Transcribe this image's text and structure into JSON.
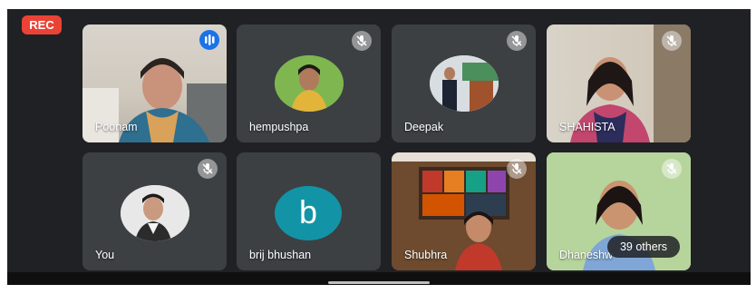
{
  "recording": {
    "label": "REC",
    "color": "#ea4335"
  },
  "participants": [
    {
      "name": "Poonam",
      "state": "speaking",
      "icon": "audio-wave-icon"
    },
    {
      "name": "hempushpa",
      "state": "muted",
      "icon": "mic-off-icon"
    },
    {
      "name": "Deepak",
      "state": "muted",
      "icon": "mic-off-icon"
    },
    {
      "name": "SHAHISTA",
      "state": "muted",
      "icon": "mic-off-icon"
    },
    {
      "name": "You",
      "state": "muted",
      "icon": "mic-off-icon"
    },
    {
      "name": "brij bhushan",
      "state": "muted",
      "icon": "mic-off-icon",
      "avatar_letter": "b",
      "avatar_color": "#1294a6"
    },
    {
      "name": "Shubhra",
      "state": "muted",
      "icon": "mic-off-icon"
    },
    {
      "name": "Dhaneshwari",
      "display_name": "Dhaneshw",
      "state": "muted",
      "icon": "mic-off-icon"
    }
  ],
  "others_badge": "39 others"
}
